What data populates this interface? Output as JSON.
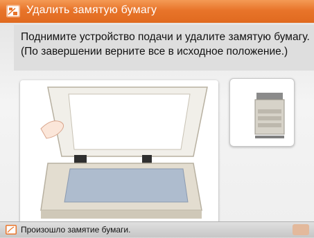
{
  "header": {
    "title": "Удалить замятую бумагу",
    "icon": "paper-jam-icon"
  },
  "message": {
    "line1": "Поднимите устройство подачи и удалите замятую бумагу.",
    "line2": "(По завершении верните все в исходное положение.)"
  },
  "illustrations": {
    "main": "scanner-open-feeder-illustration",
    "thumbnail": "copier-machine-illustration"
  },
  "status": {
    "text": "Произошло замятие бумаги.",
    "icon": "paper-jam-icon"
  },
  "colors": {
    "accent": "#e8742a",
    "background": "#efefef"
  }
}
